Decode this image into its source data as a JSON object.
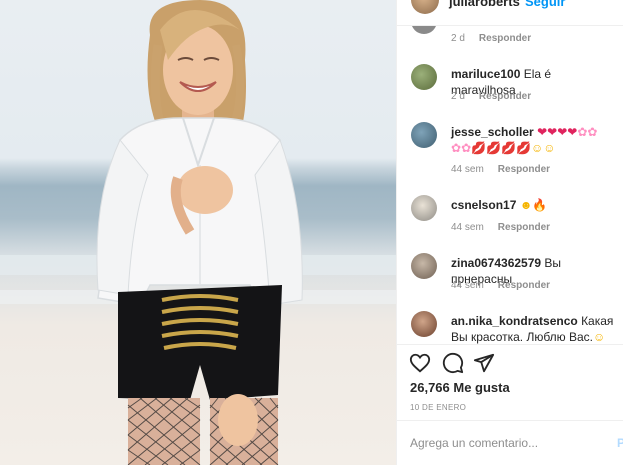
{
  "post_header": {
    "username": "juliaroberts",
    "follow_label": "Seguir"
  },
  "comments": [
    {
      "username": "",
      "text": "",
      "time": "2 d",
      "reply_label": "Responder"
    },
    {
      "username": "mariluce100",
      "text": "Ela é maravilhosa",
      "time": "2 d",
      "reply_label": "Responder"
    },
    {
      "username": "jesse_scholler",
      "emoji_line1": [
        "❤",
        "❤",
        "❤",
        "❤",
        "✿",
        "✿"
      ],
      "emoji_line2": [
        "✿",
        "✿",
        "💋",
        "💋",
        "💋",
        "💋",
        "☺",
        "☺"
      ],
      "time": "44 sem",
      "reply_label": "Responder"
    },
    {
      "username": "csnelson17",
      "emojis": [
        "☻",
        "🔥"
      ],
      "time": "44 sem",
      "reply_label": "Responder"
    },
    {
      "username": "zina0674362579",
      "text": "Вы прнерасны",
      "time": "44 sem",
      "reply_label": "Responder"
    },
    {
      "username": "an.nika_kondratsenco",
      "text": "Какая Вы красотка. Люблю Вас.",
      "emoji": "☺"
    }
  ],
  "actions": {
    "like_icon": "heart-icon",
    "comment_icon": "comment-icon",
    "share_icon": "share-icon"
  },
  "likes_text": "26,766 Me gusta",
  "post_date": "10 DE ENERO",
  "add_comment": {
    "placeholder": "Agrega un comentario...",
    "publish_label": "P"
  },
  "colors": {
    "accent_blue": "#0095f6",
    "text_primary": "#262626",
    "text_secondary": "#8e8e8e",
    "divider": "#efefef"
  }
}
